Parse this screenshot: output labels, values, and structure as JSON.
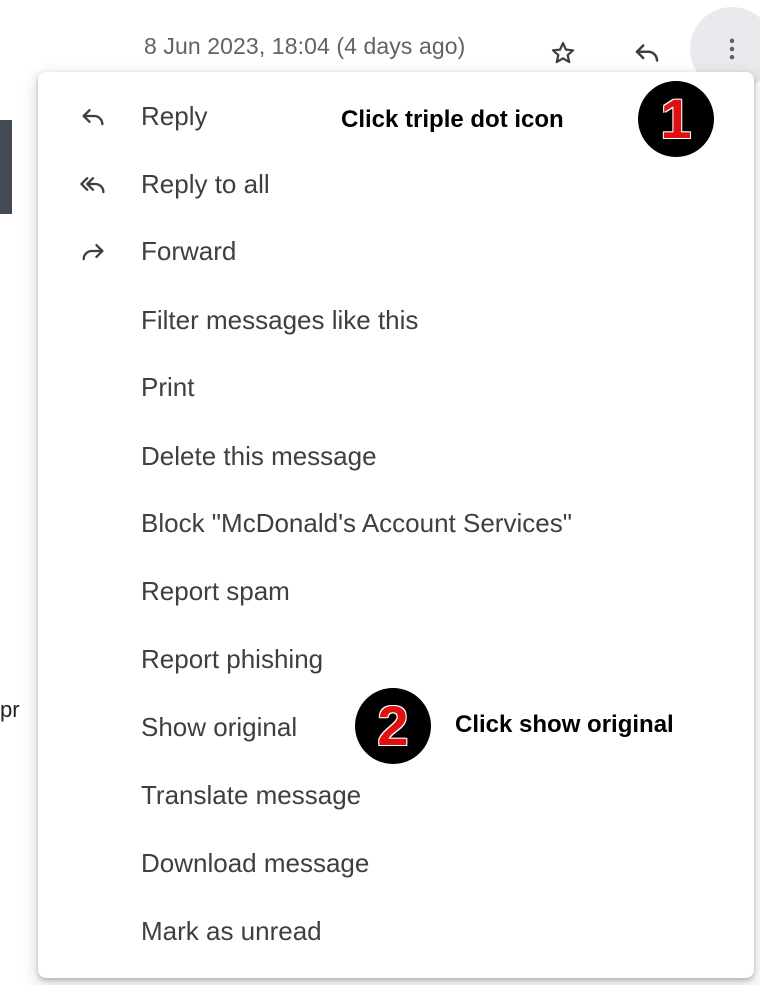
{
  "header": {
    "date": "8 Jun 2023, 18:04 (4 days ago)",
    "icons": [
      "star-icon",
      "reply-icon",
      "more-vert-icon"
    ]
  },
  "background": {
    "partial_text": "pr"
  },
  "menu": {
    "items": [
      {
        "label": "Reply",
        "icon": "reply-icon"
      },
      {
        "label": "Reply to all",
        "icon": "reply-all-icon"
      },
      {
        "label": "Forward",
        "icon": "forward-icon"
      },
      {
        "label": "Filter messages like this",
        "icon": ""
      },
      {
        "label": "Print",
        "icon": ""
      },
      {
        "label": "Delete this message",
        "icon": ""
      },
      {
        "label": "Block \"McDonald's Account Services\"",
        "icon": ""
      },
      {
        "label": "Report spam",
        "icon": ""
      },
      {
        "label": "Report phishing",
        "icon": ""
      },
      {
        "label": "Show original",
        "icon": ""
      },
      {
        "label": "Translate message",
        "icon": ""
      },
      {
        "label": "Download message",
        "icon": ""
      },
      {
        "label": "Mark as unread",
        "icon": ""
      }
    ]
  },
  "annotations": {
    "step1": {
      "number": "1",
      "text": "Click triple dot icon"
    },
    "step2": {
      "number": "2",
      "text": "Click show original"
    }
  },
  "colors": {
    "badge_number": "#e01010",
    "hover_circle": "#e8eaed",
    "icon_gray": "#5f6368"
  }
}
